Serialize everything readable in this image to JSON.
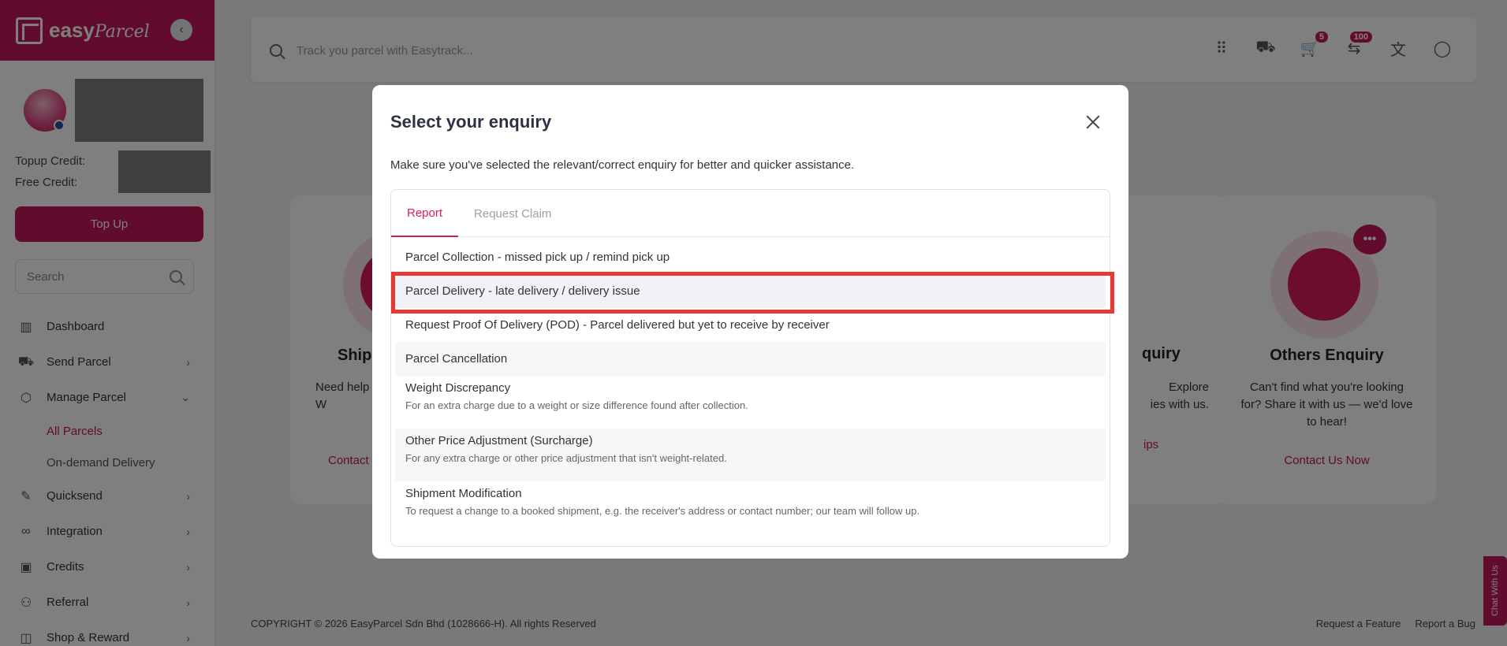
{
  "brand": {
    "logo_text": "easy",
    "logo_script": "Parcel"
  },
  "profile": {
    "topup_credit_label": "Topup Credit:",
    "free_credit_label": "Free Credit:"
  },
  "sidebar": {
    "topup_label": "Top Up",
    "search_placeholder": "Search",
    "items": [
      {
        "label": "Dashboard"
      },
      {
        "label": "Send Parcel"
      },
      {
        "label": "Manage Parcel"
      },
      {
        "label": "All Parcels"
      },
      {
        "label": "On-demand Delivery"
      },
      {
        "label": "Quicksend"
      },
      {
        "label": "Integration"
      },
      {
        "label": "Credits"
      },
      {
        "label": "Referral"
      },
      {
        "label": "Shop & Reward"
      }
    ]
  },
  "topbar": {
    "search_placeholder": "Track you parcel with Easytrack...",
    "cart_badge": "5",
    "notif_badge": "100"
  },
  "cards": {
    "left": {
      "title": "Shipm",
      "desc": "Need help\nW",
      "link": "Contact"
    },
    "mid": {
      "title": "quiry",
      "desc": "Explore\nies with us.",
      "link": "ips"
    },
    "right": {
      "title": "Others Enquiry",
      "desc": "Can't find what you're looking for? Share it with us — we'd love to hear!",
      "link": "Contact Us Now"
    }
  },
  "modal": {
    "title": "Select your enquiry",
    "subtitle": "Make sure you've selected the relevant/correct enquiry for better and quicker assistance.",
    "tabs": [
      {
        "label": "Report"
      },
      {
        "label": "Request Claim"
      }
    ],
    "items": [
      {
        "title": "Parcel Collection - missed pick up / remind pick up",
        "desc": ""
      },
      {
        "title": "Parcel Delivery - late delivery / delivery issue",
        "desc": ""
      },
      {
        "title": "Request Proof Of Delivery (POD) - Parcel delivered but yet to receive by receiver",
        "desc": ""
      },
      {
        "title": "Parcel Cancellation",
        "desc": ""
      },
      {
        "title": "Weight Discrepancy",
        "desc": "For an extra charge due to a weight or size difference found after collection."
      },
      {
        "title": "Other Price Adjustment (Surcharge)",
        "desc": "For any extra charge or other price adjustment that isn't weight-related."
      },
      {
        "title": "Shipment Modification",
        "desc": "To request a change to a booked shipment, e.g. the receiver's address or contact number; our team will follow up."
      }
    ]
  },
  "footer": {
    "copyright": "COPYRIGHT © 2026 EasyParcel Sdn Bhd (1028666-H). All rights Reserved",
    "request_feature": "Request a Feature",
    "report_bug": "Report a Bug",
    "chat": "Chat With Us"
  },
  "colors": {
    "brand": "#c2185b",
    "highlight": "#e53935"
  }
}
